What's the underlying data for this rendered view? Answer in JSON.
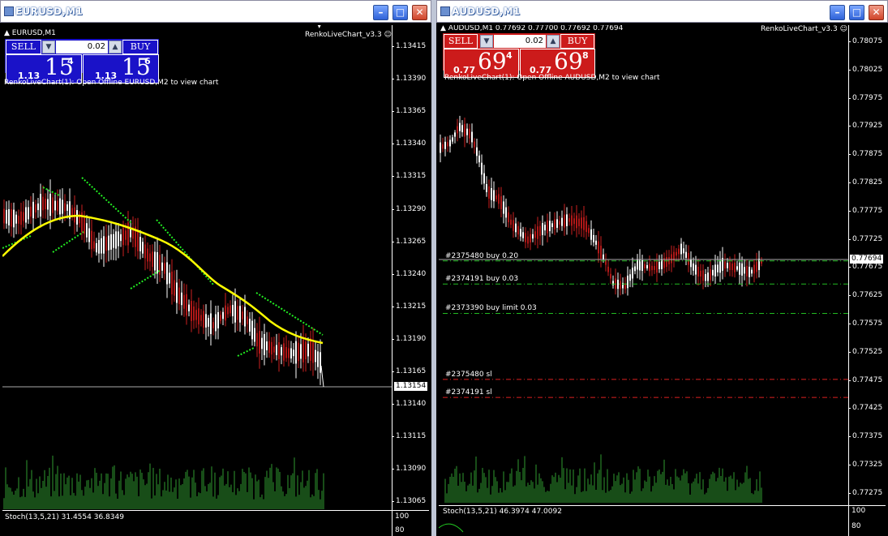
{
  "eur": {
    "title": "EURUSD,M1",
    "header": "EURUSD,M1",
    "indicator": "RenkoLiveChart_v3.3",
    "sell_label": "SELL",
    "buy_label": "BUY",
    "lot": "0.02",
    "sell_quote": {
      "small": "1.13",
      "big": "15",
      "sup": "4"
    },
    "buy_quote": {
      "small": "1.13",
      "big": "15",
      "sup": "6"
    },
    "message": "RenkoLiveChart(1): Open Offline EURUSD,M2 to view chart",
    "axis_prices": [
      "1.13415",
      "1.13390",
      "1.13365",
      "1.13340",
      "1.13315",
      "1.13290",
      "1.13265",
      "1.13240",
      "1.13215",
      "1.13190",
      "1.13165",
      "1.13140",
      "1.13115",
      "1.13090",
      "1.13065"
    ],
    "current_price": "1.13154",
    "stoch_label": "Stoch(13,5,21) 31.4554 36.8349",
    "stoch_axis": [
      "100",
      "80"
    ],
    "colors": {
      "panel": "#1a12c8",
      "ma": "#ffff00",
      "renko": "#00cc00",
      "volume": "#2f8f2f"
    }
  },
  "aud": {
    "title": "AUDUSD,M1",
    "header": "AUDUSD,M1  0.77692 0.77700 0.77692 0.77694",
    "indicator": "RenkoLiveChart_v3.3",
    "sell_label": "SELL",
    "buy_label": "BUY",
    "lot": "0.02",
    "sell_quote": {
      "small": "0.77",
      "big": "69",
      "sup": "4"
    },
    "buy_quote": {
      "small": "0.77",
      "big": "69",
      "sup": "8"
    },
    "message": "RenkoLiveChart(1): Open Offline AUDUSD,M2 to view chart",
    "axis_prices": [
      "0.78075",
      "0.78025",
      "0.77975",
      "0.77925",
      "0.77875",
      "0.77825",
      "0.77775",
      "0.77725",
      "0.77675",
      "0.77625",
      "0.77575",
      "0.77525",
      "0.77475",
      "0.77425",
      "0.77375",
      "0.77325",
      "0.77275"
    ],
    "current_price": "0.77694",
    "orders": [
      {
        "label": "#2375480 buy 0.20",
        "price": 0.77686,
        "color": "#22bb22"
      },
      {
        "label": "#2374191 buy 0.03",
        "price": 0.77645,
        "color": "#22bb22"
      },
      {
        "label": "#2373390 buy limit 0.03",
        "price": 0.77593,
        "color": "#22bb22"
      },
      {
        "label": "#2375480 sl",
        "price": 0.77476,
        "color": "#dd2222"
      },
      {
        "label": "#2374191 sl",
        "price": 0.77444,
        "color": "#dd2222"
      }
    ],
    "stoch_label": "Stoch(13,5,21) 46.3974 47.0092",
    "stoch_axis": [
      "100",
      "80"
    ],
    "colors": {
      "panel": "#cc1b1b",
      "volume": "#2f8f2f"
    }
  }
}
